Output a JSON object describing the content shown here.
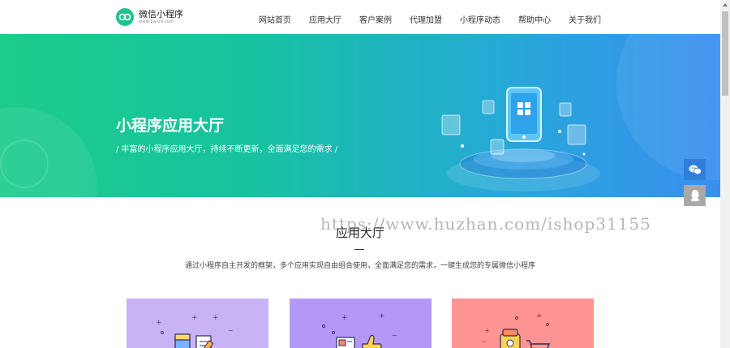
{
  "header": {
    "logo_title": "微信小程序",
    "logo_sub": "www.baiud.com",
    "nav": [
      "网站首页",
      "应用大厅",
      "客户案例",
      "代理加盟",
      "小程序动态",
      "帮助中心",
      "关于我们"
    ]
  },
  "banner": {
    "title": "小程序应用大厅",
    "subtitle": "/ 丰富的小程序应用大厅，持续不断更新，全面满足您的需求 /"
  },
  "section": {
    "title": "应用大厅",
    "description": "通过小程序自主开发的框架，多个应用实现自由组合使用，全面满足您的需求，一键生成您的专属微信小程序"
  },
  "watermark": "https://www.huzhan.com/ishop31155",
  "side_buttons": [
    "wechat-icon",
    "qq-icon"
  ],
  "colors": {
    "brand_green": "#1fc38f",
    "card_1": "#c7b3f6",
    "card_2": "#b398f8",
    "card_3": "#ff9494",
    "side_active": "#2f7fd8"
  }
}
